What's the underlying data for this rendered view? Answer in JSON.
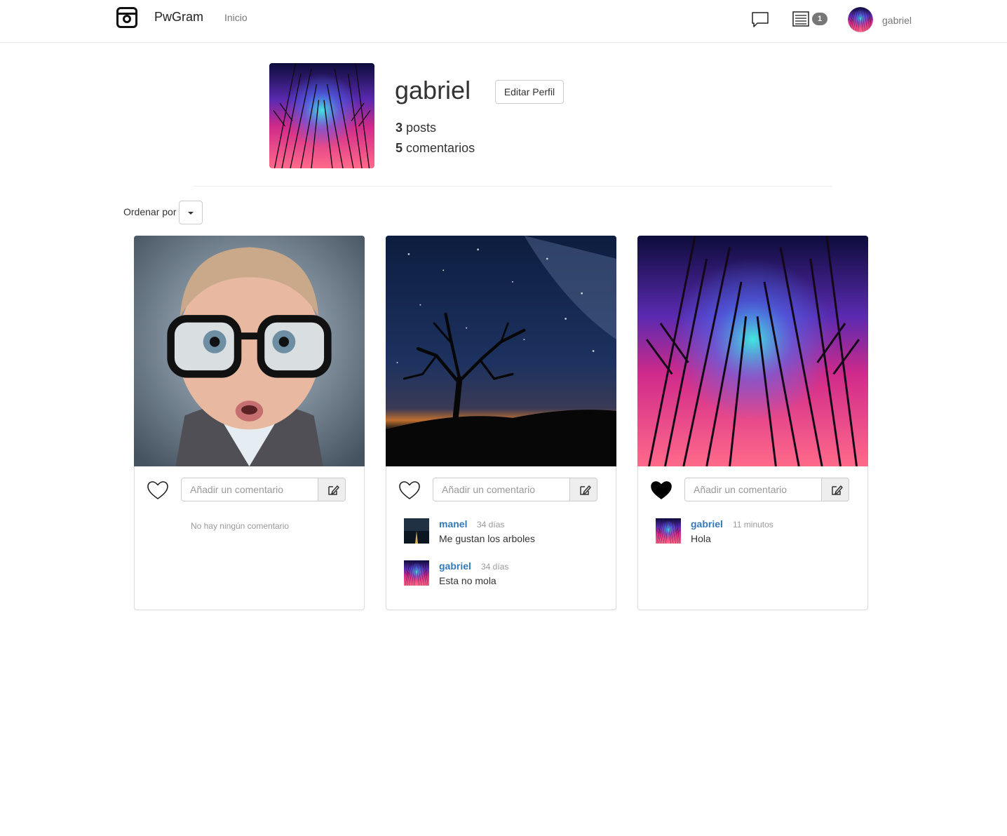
{
  "navbar": {
    "brand": "PwGram",
    "home_link": "Inicio",
    "chat_icon": "chat-bubble-icon",
    "notifications_icon": "list-icon",
    "notifications_count": "1",
    "username": "gabriel"
  },
  "profile": {
    "name": "gabriel",
    "edit_label": "Editar Perfil",
    "posts_count": "3",
    "posts_label": "posts",
    "comments_count": "5",
    "comments_label": "comentarios"
  },
  "sort": {
    "label": "Ordenar por"
  },
  "posts": [
    {
      "liked": false,
      "comment_placeholder": "Añadir un comentario",
      "empty_label": "No hay ningún comentario",
      "comments": []
    },
    {
      "liked": false,
      "comment_placeholder": "Añadir un comentario",
      "comments": [
        {
          "user": "manel",
          "time": "34 días",
          "text": "Me gustan los arboles"
        },
        {
          "user": "gabriel",
          "time": "34 días",
          "text": "Esta no mola"
        }
      ]
    },
    {
      "liked": true,
      "comment_placeholder": "Añadir un comentario",
      "comments": [
        {
          "user": "gabriel",
          "time": "11 minutos",
          "text": "Hola"
        }
      ]
    }
  ],
  "colors": {
    "link": "#337ab7",
    "muted": "#999999",
    "badge": "#777777"
  }
}
